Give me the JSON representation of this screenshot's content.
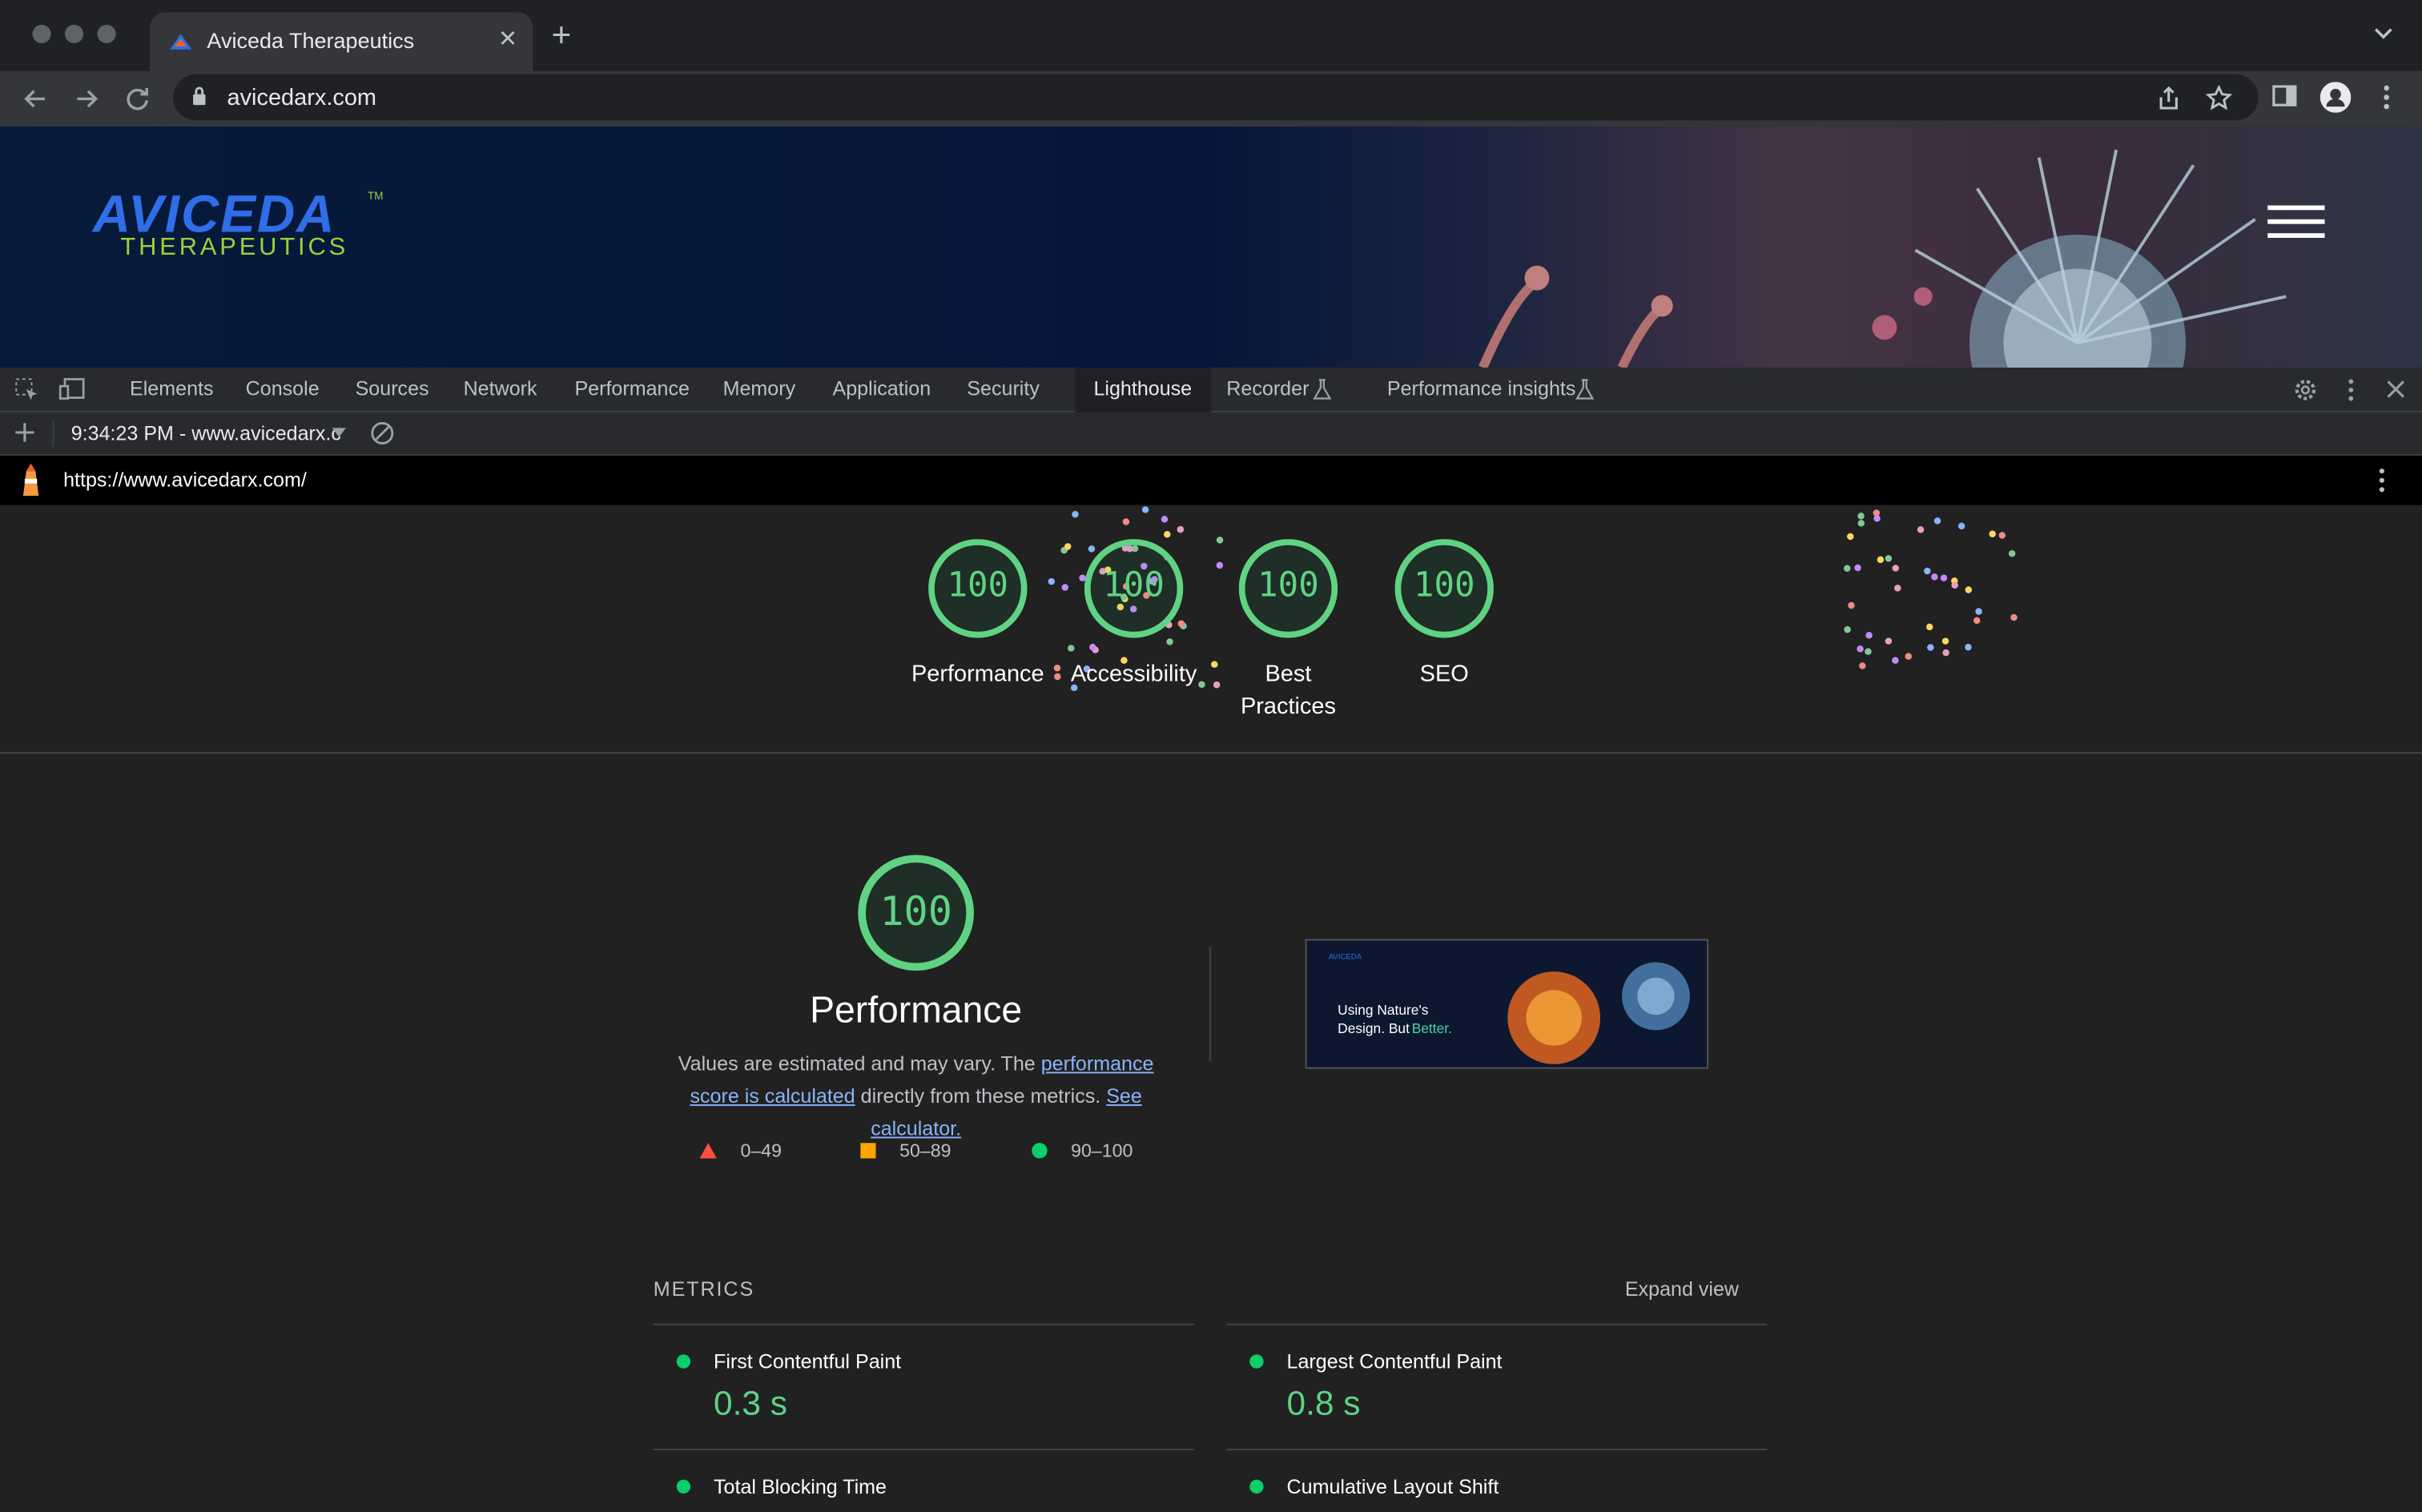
{
  "browser": {
    "tab_title": "Aviceda Therapeutics",
    "address": "avicedarx.com"
  },
  "site": {
    "logo_main": "AVICEDA",
    "logo_sub": "THERAPEUTICS",
    "logo_tm": "TM"
  },
  "devtools": {
    "tabs": [
      "Elements",
      "Console",
      "Sources",
      "Network",
      "Performance",
      "Memory",
      "Application",
      "Security",
      "Lighthouse",
      "Recorder",
      "Performance insights"
    ],
    "active_tab": "Lighthouse",
    "report_label": "9:34:23 PM - www.avicedarx.c",
    "report_url": "https://www.avicedarx.com/"
  },
  "scores": [
    {
      "label": "Performance",
      "value": "100"
    },
    {
      "label": "Accessibility",
      "value": "100"
    },
    {
      "label": "Best Practices",
      "value": "100"
    },
    {
      "label": "SEO",
      "value": "100"
    }
  ],
  "performance": {
    "score": "100",
    "title": "Performance",
    "desc_1": "Values are estimated and may vary. The ",
    "desc_link_1": "performance score is calculated",
    "desc_2": " directly from these metrics. ",
    "desc_link_2": "See calculator.",
    "legend": [
      "0–49",
      "50–89",
      "90–100"
    ],
    "thumbnail_text_1": "Using Nature's",
    "thumbnail_text_2": "Design. But",
    "thumbnail_text_3": "Better."
  },
  "metrics": {
    "heading": "METRICS",
    "expand_label": "Expand view",
    "items": [
      {
        "name": "First Contentful Paint",
        "value": "0.3 s"
      },
      {
        "name": "Largest Contentful Paint",
        "value": "0.8 s"
      },
      {
        "name": "Total Blocking Time",
        "value": ""
      },
      {
        "name": "Cumulative Layout Shift",
        "value": ""
      }
    ]
  },
  "colors": {
    "pass": "#5fd383",
    "average": "#ffa400",
    "fail": "#ff4e42",
    "link": "#8ab4f8"
  }
}
